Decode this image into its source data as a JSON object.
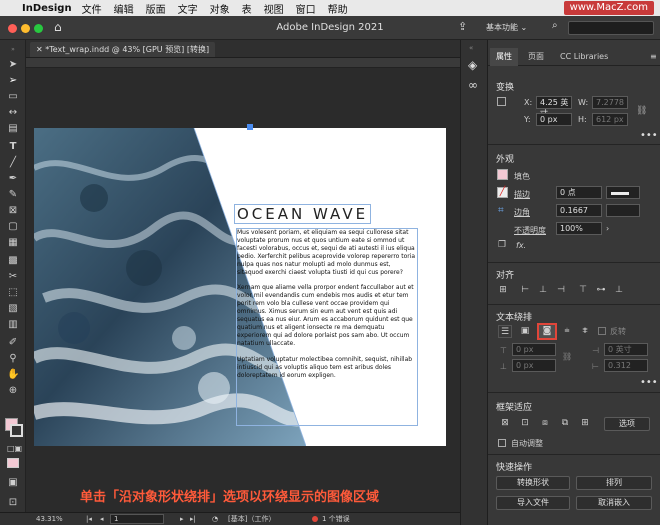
{
  "menubar": {
    "app": "InDesign",
    "items": [
      "文件",
      "编辑",
      "版面",
      "文字",
      "对象",
      "表",
      "视图",
      "窗口",
      "帮助"
    ]
  },
  "watermark": "www.MacZ.com",
  "window": {
    "title": "Adobe InDesign 2021",
    "workspace": "基本功能 ⌄"
  },
  "doc_tab": {
    "label": "*Text_wrap.indd @ 43% [GPU 预览] [转换]"
  },
  "document": {
    "headline": "OCEAN WAVE",
    "paragraphs": [
      "Mus volesent poriam, et eliquiam ea sequi cullorese sitat voluptate prorum nus et quos untium eate si ommod ut facesti volorabus, occus et, sequi de ati autesti il ius eliqua pedio. Xerferchit pelibus aceprovide volorep repererro toria nulpa quas nos natur molupti ad molo dunmus est, sitaquod exerchi ciaest volupta tiusti id qui cus porere?",
      "Xernam que aliame vella prorpor endent faccullabor aut et volor mil evendandis cum endebis mos audis et etur tem porit rem volo bla cullese vent occae providem qui omnimus. Ximus serum sin eum aut vent est quis adi sequatus ea nus eiur. Arum es accaborum quidunt est que quatium nus et aligent ionsecte re ma demquatu experiorem qui ad dolore porlaist pos sam abo. Ut occum natatium ullaccate.",
      "Uptatiam voluptatur molectibea comnihit, sequist, nihillab intiuscid qui as voluptis aliquo tem est aribus doles doloreptatem id eorum expligen."
    ]
  },
  "caption": "单击「沿对象形状绕排」选项以环绕显示的图像区域",
  "statusbar": {
    "zoom": "43.31%",
    "page": "1",
    "style": "[基本]（工作）",
    "errors": "1 个错误"
  },
  "panel": {
    "tabs": [
      "属性",
      "页面",
      "CC Libraries"
    ],
    "transform": {
      "title": "变换",
      "x_label": "X:",
      "x": "4.25 英寸",
      "y_label": "Y:",
      "y": "0 px",
      "w_label": "W:",
      "w": "7.2778",
      "h_label": "H:",
      "h": "612 px"
    },
    "appearance": {
      "title": "外观",
      "fill_label": "填色",
      "stroke_label": "描边",
      "stroke_value": "0 点",
      "corner_label": "边角",
      "corner_value": "0.1667",
      "opacity_label": "不透明度",
      "opacity_value": "100%",
      "fx_label": "fx."
    },
    "align": {
      "title": "对齐"
    },
    "textwrap": {
      "title": "文本绕排",
      "invert_label": "反转",
      "top_offset": "0 px",
      "right_offset": "0 英寸",
      "bottom_offset": "0 px",
      "left_offset": "0.312"
    },
    "frame_fit": {
      "title": "框架适应",
      "options_button": "选项",
      "auto_fit_label": "自动调整"
    },
    "quick_actions": {
      "title": "快速操作",
      "convert_shape": "转换形状",
      "arrange": "排列",
      "import_file": "导入文件",
      "cancel_embed": "取消嵌入"
    }
  },
  "colors": {
    "accent_highlight": "#e0463a",
    "selection_frame": "#8fb3e0"
  }
}
